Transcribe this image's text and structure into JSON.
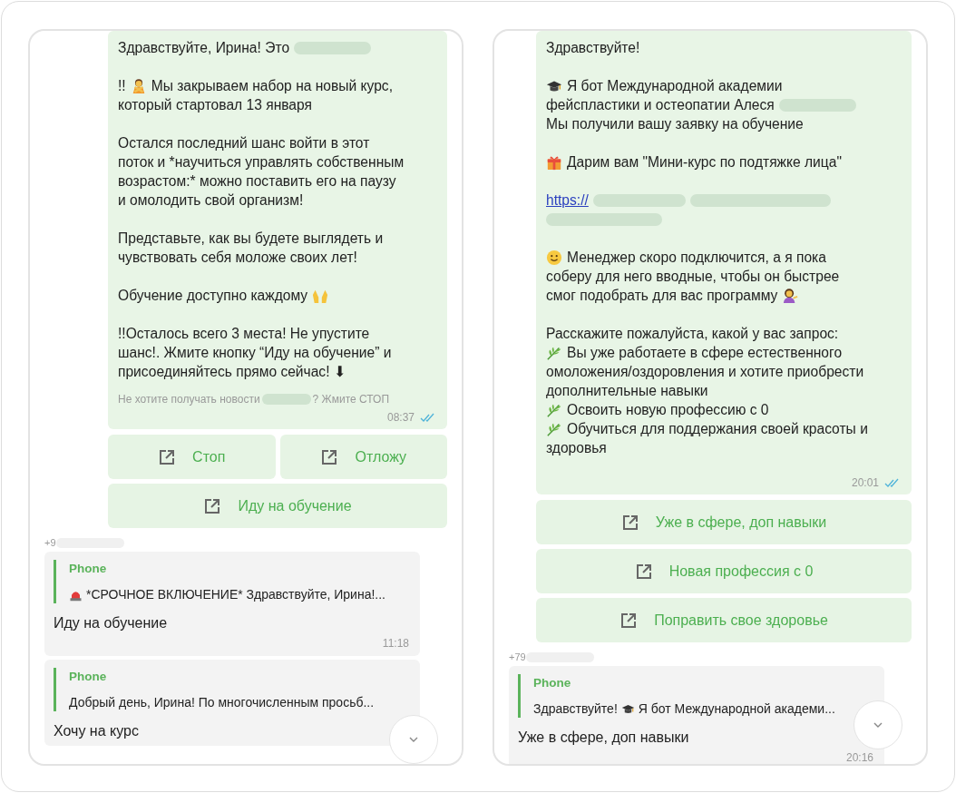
{
  "panels": [
    {
      "message": {
        "paragraphs": [
          {
            "lines": [
              {
                "text": "Здравствуйте, Ирина! Это",
                "redacted": true
              }
            ]
          },
          {
            "lines": [
              {
                "text": "!!",
                "kind": "person",
                "text2": "Мы закрываем набор на новый курс,"
              },
              {
                "text": "который стартовал 13 января"
              }
            ]
          },
          {
            "lines": [
              {
                "text": "Остался последний шанс войти в этот"
              },
              {
                "text": "поток и *научиться управлять собственным"
              },
              {
                "text": "возрастом:* можно поставить его на паузу"
              },
              {
                "text": "и омолодить свой организм!"
              }
            ]
          },
          {
            "lines": [
              {
                "text": "Представьте, как вы будете выглядеть и"
              },
              {
                "text": "чувствовать себя моложе своих лет!"
              }
            ]
          },
          {
            "lines": [
              {
                "text": "Обучение доступно каждому",
                "kind": "hands"
              }
            ]
          },
          {
            "lines": [
              {
                "text": "!!Осталось всего 3 места! Не упустите"
              },
              {
                "text": "шанс!. Жмите кнопку “Иду на обучение” и"
              },
              {
                "text": "присоединяйтесь прямо сейчас! ⬇"
              }
            ]
          }
        ],
        "footer": {
          "before": "Не хотите получать новости",
          "after": "? Жмите СТОП"
        },
        "time": "08:37",
        "read": true
      },
      "buttons": [
        [
          {
            "label": "Стоп"
          },
          {
            "label": "Отложу"
          }
        ],
        [
          {
            "label": "Иду на обучение"
          }
        ]
      ],
      "sender": "+9",
      "replies": [
        {
          "quote_author": "Phone",
          "kind": "siren",
          "quote_text": "*СРОЧНОЕ ВКЛЮЧЕНИЕ* Здравствуйте, Ирина!...",
          "text": "Иду на обучение",
          "time": "11:18"
        },
        {
          "quote_author": "Phone",
          "quote_text": "Добрый день, Ирина! По многочисленным просьб...",
          "text": "Хочу на курс"
        }
      ]
    },
    {
      "message": {
        "paragraphs": [
          {
            "lines": [
              {
                "text": "Здравствуйте!"
              }
            ]
          },
          {
            "lines": [
              {
                "kind": "cap",
                "text": "Я бот Международной академии"
              },
              {
                "text": "фейспластики и остеопатии Алеся",
                "redacted": true
              },
              {
                "text": "Мы получили вашу заявку на обучение"
              }
            ]
          },
          {
            "lines": [
              {
                "kind": "gift",
                "text": "Дарим вам \"Мини-курс по подтяжке лица\""
              }
            ]
          },
          {
            "kind": "link",
            "lines": [
              {
                "text": "https://"
              }
            ]
          },
          {
            "lines": [
              {
                "kind": "smile",
                "text": "Менеджер скоро подключится, а я пока"
              },
              {
                "text": "соберу для него вводные, чтобы он быстрее"
              },
              {
                "text": "смог подобрать для вас программу",
                "kind": "woman"
              }
            ]
          },
          {
            "lines": [
              {
                "text": "Расскажите пожалуйста, какой у вас запрос:"
              },
              {
                "kind": "leaf",
                "text": "Вы уже работаете в сфере естественного"
              },
              {
                "text": "омоложения/оздоровления и хотите приобрести"
              },
              {
                "text": "дополнительные навыки"
              },
              {
                "kind": "leaf",
                "text": "Освоить новую профессию с 0"
              },
              {
                "kind": "leaf",
                "text": "Обучиться для поддержания своей красоты и"
              },
              {
                "text": "здоровья"
              }
            ]
          }
        ],
        "time": "20:01",
        "read": true
      },
      "buttons": [
        [
          {
            "label": "Уже в сфере, доп навыки"
          }
        ],
        [
          {
            "label": "Новая профессия с 0"
          }
        ],
        [
          {
            "label": "Поправить свое здоровье"
          }
        ]
      ],
      "sender": "+79",
      "replies": [
        {
          "quote_author": "Phone",
          "quote_text": "Здравствуйте!",
          "kind": "cap",
          "quote_text2": "Я бот Международной академи...",
          "text": "Уже в сфере, доп навыки",
          "time": "20:16"
        }
      ]
    }
  ]
}
